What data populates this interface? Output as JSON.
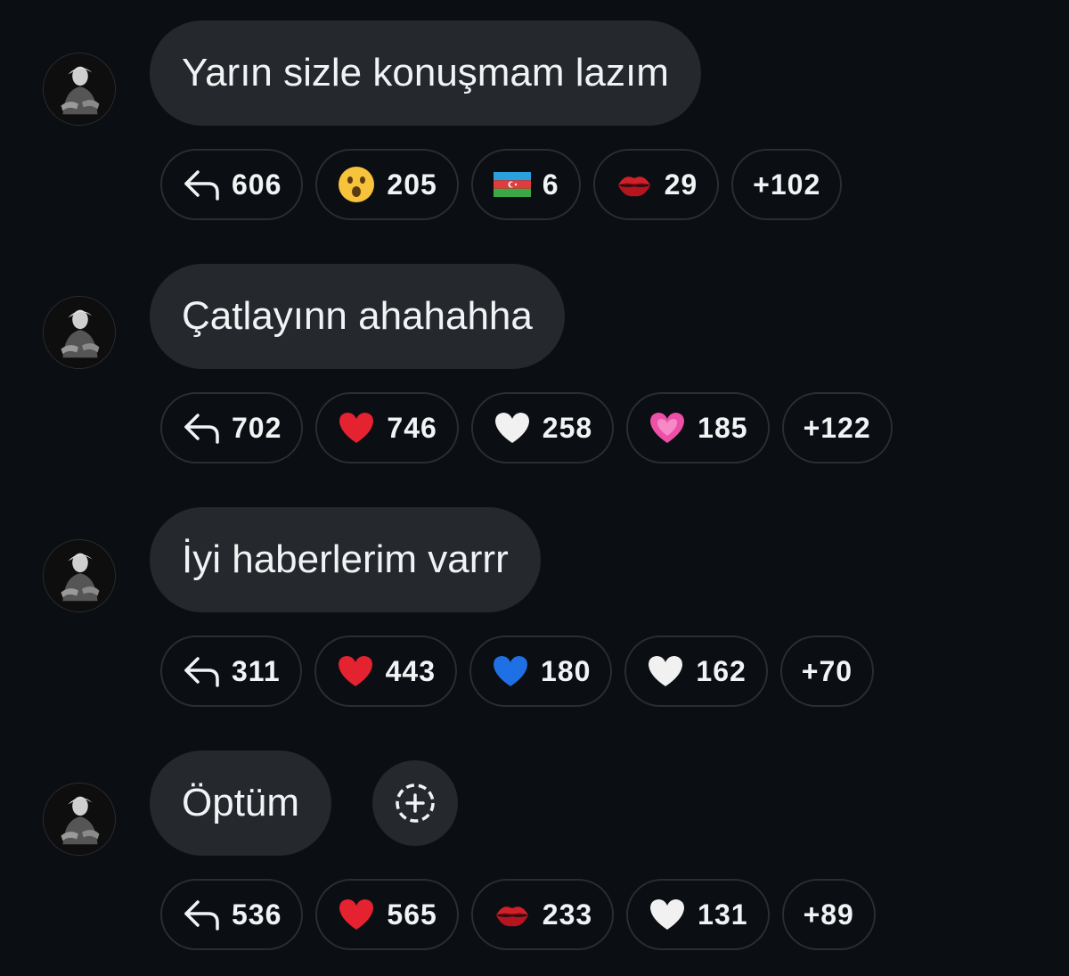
{
  "messages": [
    {
      "text": "Yarın sizle konuşmam lazım",
      "reactions": [
        {
          "icon": "reply-icon",
          "count": "606"
        },
        {
          "icon": "surprised-face-icon",
          "count": "205"
        },
        {
          "icon": "azerbaijan-flag-icon",
          "count": "6"
        },
        {
          "icon": "kiss-mark-icon",
          "count": "29"
        }
      ],
      "more": "+102"
    },
    {
      "text": "Çatlayınn ahahahha",
      "reactions": [
        {
          "icon": "reply-icon",
          "count": "702"
        },
        {
          "icon": "red-heart-icon",
          "count": "746"
        },
        {
          "icon": "white-heart-icon",
          "count": "258"
        },
        {
          "icon": "pink-heart-icon",
          "count": "185"
        }
      ],
      "more": "+122"
    },
    {
      "text": "İyi haberlerim varrr",
      "reactions": [
        {
          "icon": "reply-icon",
          "count": "311"
        },
        {
          "icon": "red-heart-icon",
          "count": "443"
        },
        {
          "icon": "blue-heart-icon",
          "count": "180"
        },
        {
          "icon": "white-heart-icon",
          "count": "162"
        }
      ],
      "more": "+70"
    },
    {
      "text": "Öptüm",
      "reactions": [
        {
          "icon": "reply-icon",
          "count": "536"
        },
        {
          "icon": "red-heart-icon",
          "count": "565"
        },
        {
          "icon": "kiss-mark-icon",
          "count": "233"
        },
        {
          "icon": "white-heart-icon",
          "count": "131"
        }
      ],
      "more": "+89"
    }
  ],
  "colors": {
    "background": "#0b0e12",
    "bubble": "#25282c",
    "chip_border": "#2a2d32",
    "text": "#f2f3f5"
  }
}
